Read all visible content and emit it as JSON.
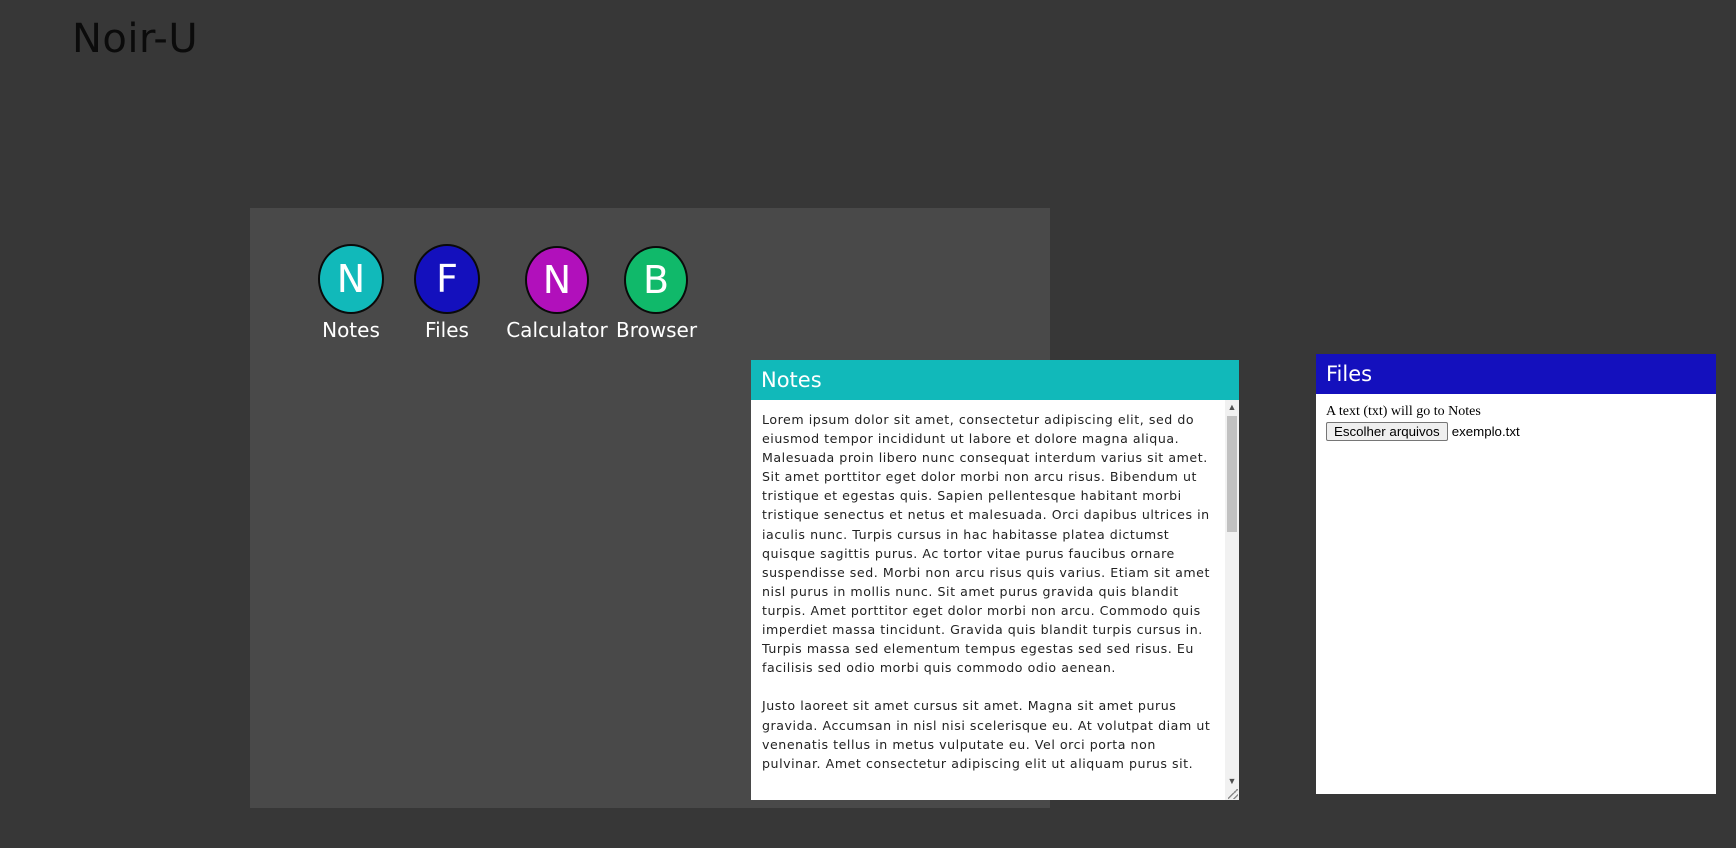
{
  "app": {
    "title": "Noir-U"
  },
  "desktop": {
    "icons": [
      {
        "letter": "N",
        "label": "Notes",
        "color": "#11b9ba"
      },
      {
        "letter": "F",
        "label": "Files",
        "color": "#1410bd"
      },
      {
        "letter": "N",
        "label": "Calculator",
        "color": "#b110bb"
      },
      {
        "letter": "B",
        "label": "Browser",
        "color": "#10b96a"
      }
    ]
  },
  "notes_window": {
    "title": "Notes",
    "color": "#11b9ba",
    "content": "Lorem ipsum dolor sit amet, consectetur adipiscing elit, sed do eiusmod tempor incididunt ut labore et dolore magna aliqua. Malesuada proin libero nunc consequat interdum varius sit amet. Sit amet porttitor eget dolor morbi non arcu risus. Bibendum ut tristique et egestas quis. Sapien pellentesque habitant morbi tristique senectus et netus et malesuada. Orci dapibus ultrices in iaculis nunc. Turpis cursus in hac habitasse platea dictumst quisque sagittis purus. Ac tortor vitae purus faucibus ornare suspendisse sed. Morbi non arcu risus quis varius. Etiam sit amet nisl purus in mollis nunc. Sit amet purus gravida quis blandit turpis. Amet porttitor eget dolor morbi non arcu. Commodo quis imperdiet massa tincidunt. Gravida quis blandit turpis cursus in. Turpis massa sed elementum tempus egestas sed sed risus. Eu facilisis sed odio morbi quis commodo odio aenean.\n\nJusto laoreet sit amet cursus sit amet. Magna sit amet purus gravida. Accumsan in nisl nisi scelerisque eu. At volutpat diam ut venenatis tellus in metus vulputate eu. Vel orci porta non pulvinar. Amet consectetur adipiscing elit ut aliquam purus sit."
  },
  "files_window": {
    "title": "Files",
    "color": "#1410bd",
    "hint": "A text (txt) will go to Notes",
    "choose_button": "Escolher arquivos",
    "file_name": "exemplo.txt"
  }
}
